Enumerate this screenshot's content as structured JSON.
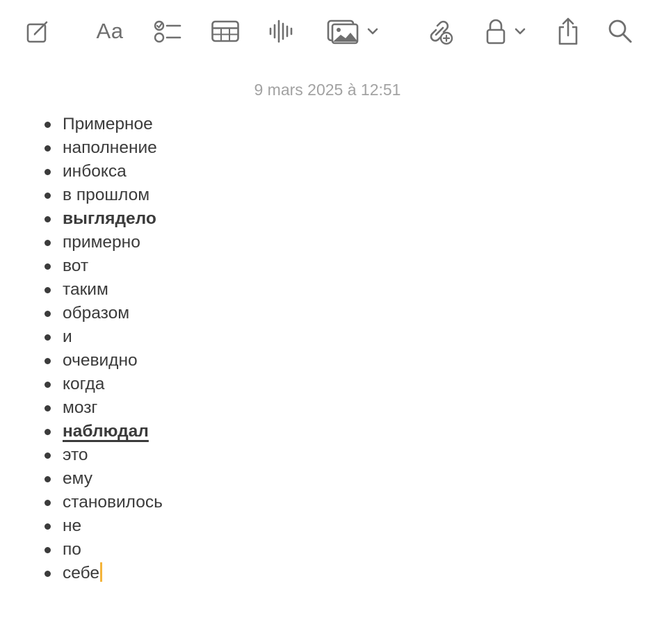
{
  "toolbar": {
    "buttons": [
      {
        "name": "compose-icon"
      },
      {
        "name": "format-text-icon",
        "label": "Aa"
      },
      {
        "name": "checklist-icon"
      },
      {
        "name": "table-icon"
      },
      {
        "name": "audio-waveform-icon"
      },
      {
        "name": "media-icon",
        "has_dropdown": true
      },
      {
        "name": "collaborate-link-icon"
      },
      {
        "name": "lock-icon",
        "has_dropdown": true
      },
      {
        "name": "share-icon"
      },
      {
        "name": "search-icon"
      }
    ],
    "icon_color": "#6f6f6f"
  },
  "note": {
    "date": "9 mars 2025 à 12:51",
    "items": [
      {
        "text": "Примерное"
      },
      {
        "text": "наполнение"
      },
      {
        "text": "инбокса"
      },
      {
        "text": "в прошлом"
      },
      {
        "text": "выглядело",
        "bold": true
      },
      {
        "text": "примерно"
      },
      {
        "text": "вот"
      },
      {
        "text": "таким"
      },
      {
        "text": "образом"
      },
      {
        "text": "и"
      },
      {
        "text": "очевидно"
      },
      {
        "text": "когда"
      },
      {
        "text": "мозг"
      },
      {
        "text": "наблюдал",
        "bold": true,
        "underline": true
      },
      {
        "text": "это"
      },
      {
        "text": "ему"
      },
      {
        "text": "становилось"
      },
      {
        "text": "не"
      },
      {
        "text": "по"
      },
      {
        "text": "себе",
        "caret": true
      }
    ],
    "caret_color": "#f4b43a"
  }
}
